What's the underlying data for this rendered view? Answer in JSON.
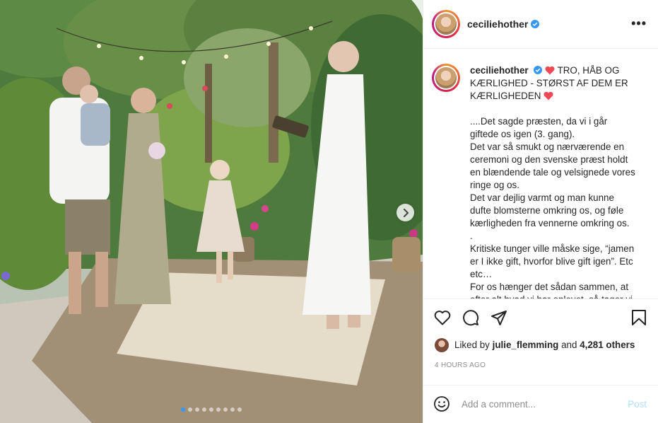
{
  "post": {
    "username": "ceciliehother",
    "verified": true,
    "more_icon": "more-horizontal-icon"
  },
  "caption": {
    "username": "ceciliehother",
    "heading": "TRO, HÅB OG KÆRLIGHED - STØRST AF DEM ER KÆRLIGHEDEN",
    "heart_emoji": "red-heart-icon",
    "lines": [
      "....Det sagde præsten, da vi i går giftede os igen (3. gang).",
      "Det var så smukt og nærværende en ceremoni og den svenske præst holdt en blændende tale og velsignede vores ringe og os.",
      "Det var dejlig varmt og man kunne dufte blomsterne omkring os, og føle kærligheden fra vennerne omkring os.",
      ".",
      "Kritiske tunger ville måske sige, “jamen er I ikke gift, hvorfor blive gift igen”. Etc etc…",
      "For os hænger det sådan sammen, at efter alt hvad vi har oplevet, så tager vi"
    ]
  },
  "actions": {
    "like_icon": "heart-outline-icon",
    "comment_icon": "comment-icon",
    "share_icon": "share-icon",
    "save_icon": "bookmark-icon"
  },
  "likes": {
    "prefix": "Liked by",
    "user": "julie_flemming",
    "conjunction": "and",
    "count": "4,281 others"
  },
  "timestamp": "4 HOURS AGO",
  "comment_box": {
    "placeholder": "Add a comment...",
    "post_label": "Post",
    "emoji_icon": "smiley-icon"
  },
  "carousel": {
    "total_slides": 9,
    "active_index": 0
  },
  "colors": {
    "verified_blue": "#3897f0",
    "heart_red": "#ed4956",
    "post_button_disabled": "#b2dffc",
    "secondary_text": "#8e8e8e",
    "border": "#efefef"
  }
}
